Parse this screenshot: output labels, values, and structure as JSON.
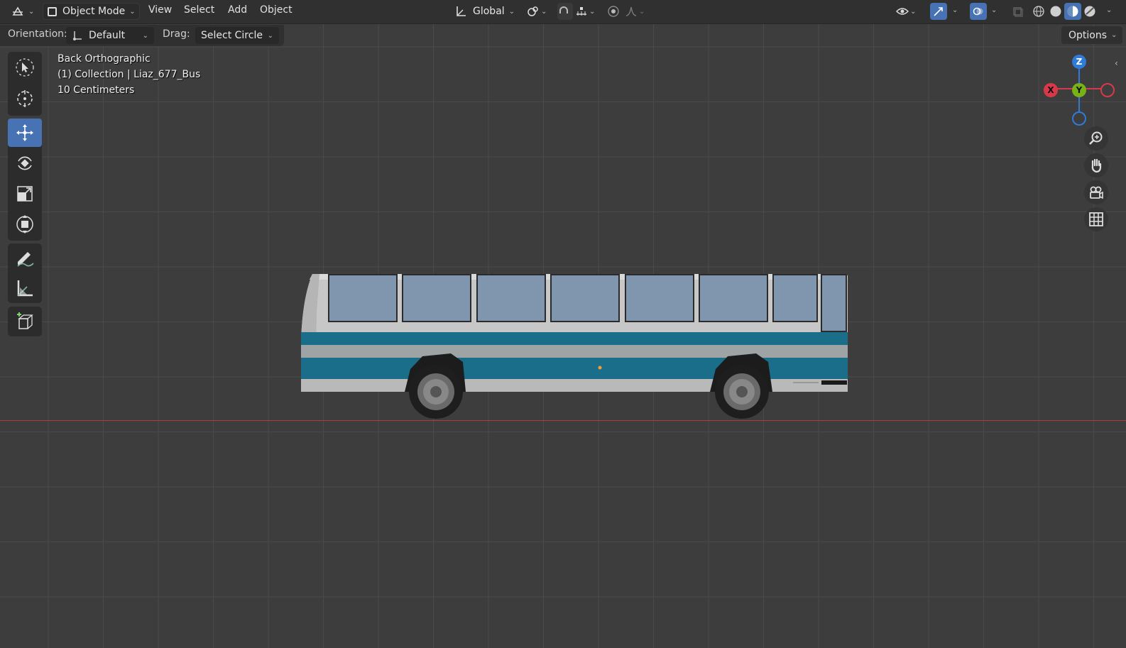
{
  "header": {
    "editor_type_icon": "viewport-3d-icon",
    "mode_label": "Object Mode",
    "menus": [
      "View",
      "Select",
      "Add",
      "Object"
    ],
    "transform_orientation": "Global"
  },
  "tool_settings": {
    "orientation_label": "Orientation:",
    "orientation_value": "Default",
    "drag_label": "Drag:",
    "drag_value": "Select Circle",
    "options_label": "Options"
  },
  "viewport_info": {
    "view_name": "Back Orthographic",
    "collection_object": "(1) Collection | Liaz_677_Bus",
    "grid_scale": "10 Centimeters"
  },
  "gizmo": {
    "z": "Z",
    "y": "Y",
    "x": "X"
  },
  "toolbar": [
    "select-box-icon",
    "cursor-icon",
    "move-icon",
    "rotate-icon",
    "scale-icon",
    "transform-icon",
    "annotate-icon",
    "measure-icon",
    "add-cube-icon"
  ],
  "active_tool": "move-icon",
  "colors": {
    "active_tool_bg": "#4772b3",
    "bus_body": "#c9c9c9",
    "bus_stripe": "#1b6e8a",
    "bus_window": "#7f96ae",
    "x_axis": "#b13a3a",
    "gizmo_x": "#d8394a",
    "gizmo_y": "#77b316",
    "gizmo_z": "#2f7bd6"
  }
}
